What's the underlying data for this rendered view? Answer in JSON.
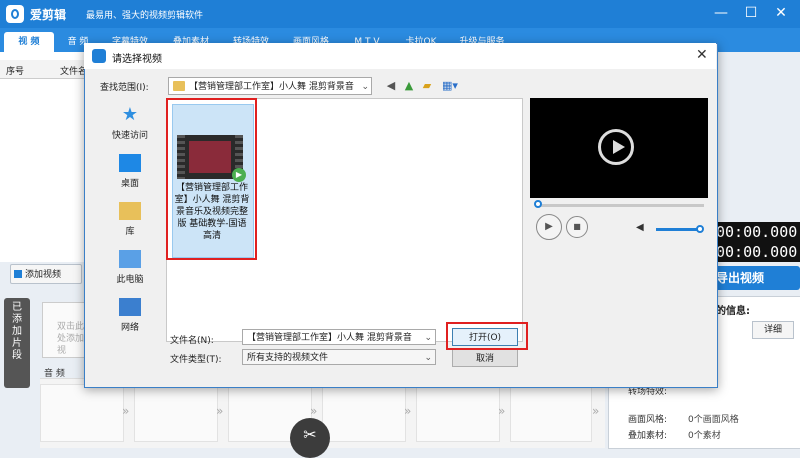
{
  "app": {
    "name": "爱剪辑",
    "slogan": "最易用、强大的视频剪辑软件",
    "window_controls": [
      "—",
      "☐",
      "✕"
    ]
  },
  "tabs": [
    "视 频",
    "音 频",
    "字幕特效",
    "叠加素材",
    "转场特效",
    "画面风格",
    "M T V",
    "卡拉OK",
    "升级与服务"
  ],
  "left": {
    "columns": [
      "序号",
      "文件名"
    ],
    "add_video": "添加视频",
    "added_clips_tab": "已添加片段",
    "clip_placeholder": "双击此处添加视",
    "audio_label": "音 频"
  },
  "right": {
    "time1": "00:00.000",
    "time2": "00:00.000",
    "export": "导出视频",
    "info_title": "的信息:",
    "detail_button": "详细",
    "rows": [
      {
        "label": "转场特效:",
        "value": ""
      },
      {
        "label": "画面风格:",
        "value": "0个画面风格"
      },
      {
        "label": "叠加素材:",
        "value": "0个素材"
      }
    ]
  },
  "dialog": {
    "title": "请选择视频",
    "lookin_label": "查找范围(I):",
    "lookin_value": "【营销管理部工作室】小人舞 混剪背景音",
    "places": [
      "快速访问",
      "桌面",
      "库",
      "此电脑",
      "网络"
    ],
    "file": {
      "name": "【营销管理部工作室】小人舞 混剪背景音乐及视频完整版 基础教学-国语高清"
    },
    "filename_label": "文件名(N):",
    "filename_value": "【营销管理部工作室】小人舞 混剪背景音",
    "filetype_label": "文件类型(T):",
    "filetype_value": "所有支持的视频文件",
    "open_button": "打开(O)",
    "cancel_button": "取消",
    "highlight_color": "#e02020"
  }
}
